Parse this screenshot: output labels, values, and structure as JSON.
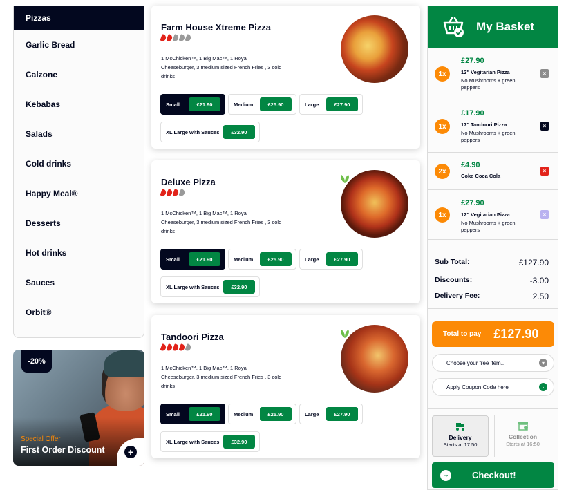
{
  "sidebar": {
    "categories": [
      "Pizzas",
      "Garlic Bread",
      "Calzone",
      "Kebabas",
      "Salads",
      "Cold drinks",
      "Happy Meal®",
      "Desserts",
      "Hot drinks",
      "Sauces",
      "Orbit®"
    ],
    "active": "Pizzas"
  },
  "promo": {
    "badge": "-20%",
    "tag": "Special Offer",
    "title": "First Order Discount",
    "plus": "+"
  },
  "products": [
    {
      "name": "Farm House Xtreme Pizza",
      "hot_chillies": 2,
      "total_chillies": 5,
      "description": "1 McChicken™, 1 Big Mac™, 1 Royal Cheeseburger, 3 medium sized French Fries , 3 cold drinks",
      "image": "farm-house-pizza-photo",
      "sizes": [
        {
          "label": "Small",
          "price": "£21.90",
          "selected": true
        },
        {
          "label": "Medium",
          "price": "£25.90",
          "selected": false
        },
        {
          "label": "Large",
          "price": "£27.90",
          "selected": false
        },
        {
          "label": "XL Large with Sauces",
          "price": "£32.90",
          "selected": false
        }
      ]
    },
    {
      "name": "Deluxe Pizza",
      "hot_chillies": 3,
      "total_chillies": 4,
      "description": "1 McChicken™, 1 Big Mac™, 1 Royal Cheeseburger, 3 medium sized French Fries , 3 cold drinks",
      "image": "deluxe-pizza-photo",
      "vegetarian_icon": "leaf-icon",
      "sizes": [
        {
          "label": "Small",
          "price": "£21.90",
          "selected": true
        },
        {
          "label": "Medium",
          "price": "£25.90",
          "selected": false
        },
        {
          "label": "Large",
          "price": "£27.90",
          "selected": false
        },
        {
          "label": "XL Large with Sauces",
          "price": "£32.90",
          "selected": false
        }
      ]
    },
    {
      "name": "Tandoori Pizza",
      "hot_chillies": 4,
      "total_chillies": 5,
      "description": "1 McChicken™, 1 Big Mac™, 1 Royal Cheeseburger, 3 medium sized French Fries , 3 cold drinks",
      "image": "tandoori-pizza-photo",
      "vegetarian_icon": "leaf-icon",
      "sizes": [
        {
          "label": "Small",
          "price": "£21.90",
          "selected": true
        },
        {
          "label": "Medium",
          "price": "£25.90",
          "selected": false
        },
        {
          "label": "Large",
          "price": "£27.90",
          "selected": false
        },
        {
          "label": "XL Large with Sauces",
          "price": "£32.90",
          "selected": false
        }
      ]
    }
  ],
  "basket": {
    "title": "My Basket",
    "items": [
      {
        "qty": "1x",
        "price": "£27.90",
        "name": "12\" Vegitarian Pizza",
        "note": "No Mushrooms + green peppers",
        "delete_color": "#8c8c8c"
      },
      {
        "qty": "1x",
        "price": "£17.90",
        "name": "17\" Tandoori Pizza",
        "note": "No Mushrooms + green peppers",
        "delete_color": "#03081f"
      },
      {
        "qty": "2x",
        "price": "£4.90",
        "name": "Coke Coca Cola",
        "note": "",
        "delete_color": "#e2231a"
      },
      {
        "qty": "1x",
        "price": "£27.90",
        "name": "12\" Vegitarian Pizza",
        "note": "No Mushrooms + green peppers",
        "delete_color": "#b9b2f0"
      }
    ],
    "subtotal_label": "Sub Total:",
    "subtotal": "£127.90",
    "discounts_label": "Discounts:",
    "discounts": "-3.00",
    "delivery_fee_label": "Delivery Fee:",
    "delivery_fee": "2.50",
    "total_label": "Total to pay",
    "total": "£127.90",
    "free_item": "Choose your free item..",
    "coupon": "Apply Coupon Code here",
    "delivery": {
      "title": "Delivery",
      "time": "Starts at 17:50"
    },
    "collection": {
      "title": "Collection",
      "time": "Starts at 16:50"
    },
    "checkout": "Checkout!"
  },
  "colors": {
    "primary_dark": "#03081f",
    "green": "#028643",
    "orange": "#fc8a06"
  }
}
